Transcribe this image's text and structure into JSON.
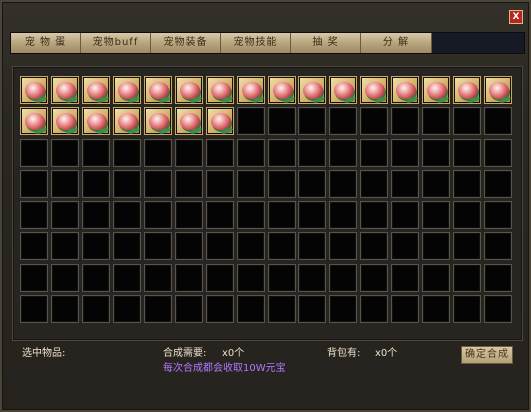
{
  "window": {
    "close_label": "X"
  },
  "tabs": [
    {
      "label": "宠 物 蛋"
    },
    {
      "label": "宠物buff"
    },
    {
      "label": "宠物装备"
    },
    {
      "label": "宠物技能"
    },
    {
      "label": "抽 奖"
    },
    {
      "label": "分 解"
    }
  ],
  "inventory": {
    "filled_count": 23,
    "total_slots": 128,
    "item_icon": "pet-egg-icon"
  },
  "footer": {
    "selected_label": "选中物品:",
    "need_label": "合成需要:",
    "need_value": "x0个",
    "bag_label": "背包有:",
    "bag_value": "x0个",
    "fee_note": "每次合成都会收取10W元宝",
    "synthesize_button": "确定合成"
  },
  "colors": {
    "tab_gold": "#b5a17b",
    "note_purple": "#b079ff",
    "close_red": "#b4281e"
  }
}
